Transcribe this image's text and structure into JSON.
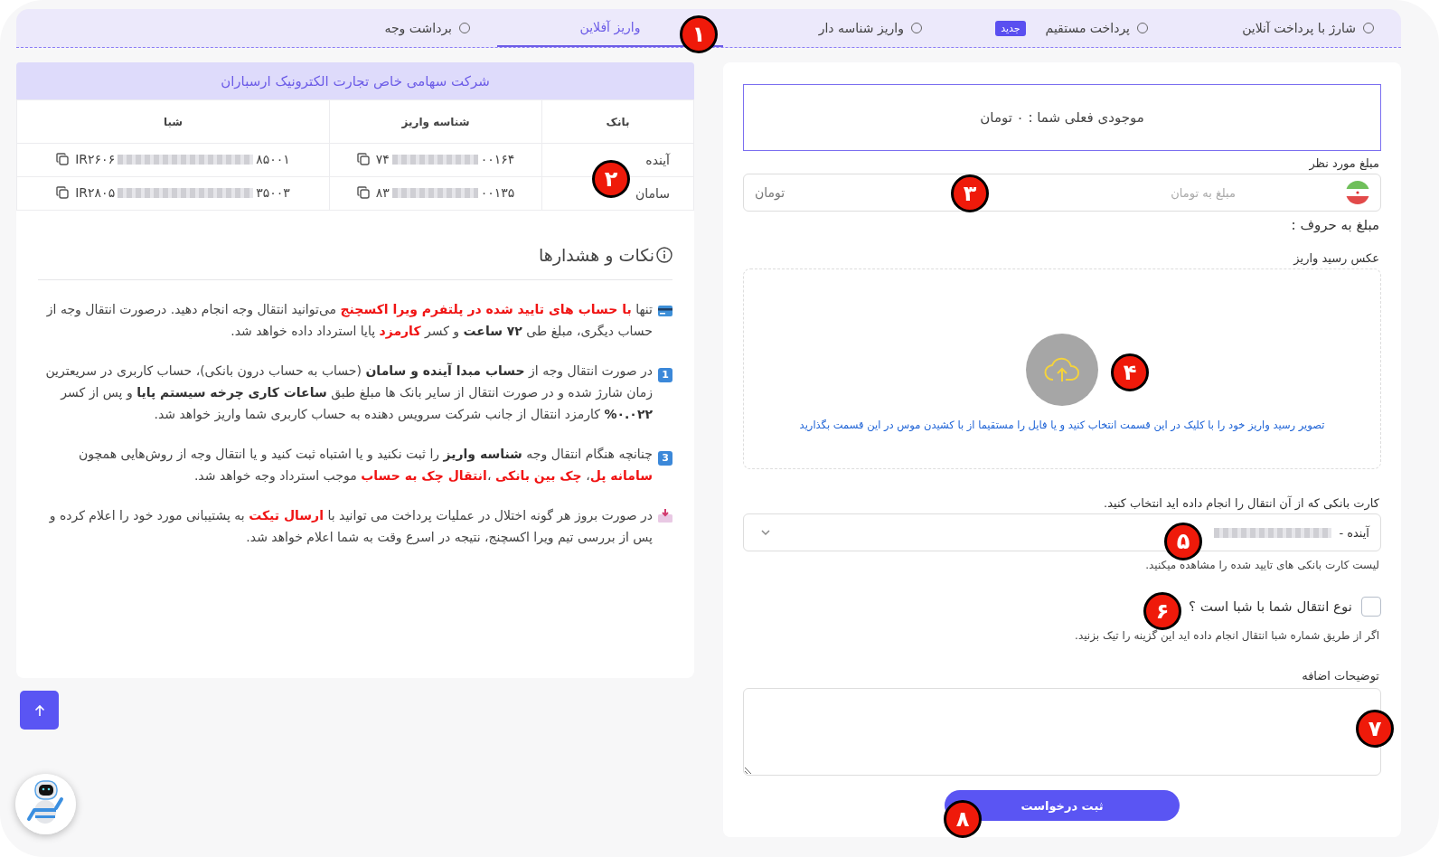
{
  "tabs": [
    {
      "label": "شارژ با پرداخت آنلاین",
      "selected": false
    },
    {
      "label": "پرداخت مستقیم",
      "badge": "جدید",
      "selected": false
    },
    {
      "label": "واریز شناسه دار",
      "selected": false
    },
    {
      "label": "واریز آفلاین",
      "selected": true
    },
    {
      "label": "برداشت وجه",
      "selected": false
    }
  ],
  "form": {
    "balance": "موجودی فعلی شما : ۰ تومان",
    "amount": {
      "label": "مبلغ مورد نظر",
      "placeholder": "مبلغ به تومان",
      "unit": "تومان"
    },
    "amount_words": "مبلغ به حروف :",
    "receipt": {
      "label": "عکس رسید واریز",
      "hint": "تصویر رسید واریز خود را با کلیک در این قسمت انتخاب کنید و یا فایل را مستقیما از با کشیدن موس در این قسمت بگذارید"
    },
    "card_select": {
      "label": "کارت بانکی که از آن انتقال را انجام داده اید انتخاب کنید.",
      "value_prefix": "آینده -",
      "help": "لیست کارت بانکی های تایید شده را مشاهده میکنید."
    },
    "sheba_checkbox": {
      "label": "نوع انتقال شما با شبا است ؟",
      "checked": false,
      "help": "اگر از طریق شماره شبا انتقال انجام داده اید این گزینه را تیک بزنید."
    },
    "notes_field": {
      "label": "توضیحات اضافه"
    },
    "submit": "ثبت درخواست"
  },
  "bank_panel": {
    "title": "شرکت سهامی خاص تجارت الکترونیک ارسباران",
    "columns": [
      "بانک",
      "شناسه واریز",
      "شبا"
    ],
    "rows": [
      {
        "bank": "آینده",
        "deposit_id_start": "۷۴",
        "deposit_id_end": "۰۰۱۶۴",
        "sheba_start": "IR۲۶۰۶",
        "sheba_end": "۸۵۰۰۱"
      },
      {
        "bank": "سامان",
        "deposit_id_start": "۸۳",
        "deposit_id_end": "۰۰۱۳۵",
        "sheba_start": "IR۲۸۰۵",
        "sheba_end": "۳۵۰۰۳"
      }
    ]
  },
  "notes": {
    "title": "نکات و هشدارها",
    "items": [
      {
        "kind": "card",
        "text": "تنها *با حساب های تایید شده در پلتفرم ویرا اکسچنج* می‌توانید انتقال وجه انجام دهید. درصورت انتقال وجه از حساب دیگری، مبلغ طی **۷۲ ساعت** و کسر *کارمزد* پایا استرداد داده خواهد شد."
      },
      {
        "kind": "keycap",
        "keycap": "1",
        "text": "در صورت انتقال وجه از **حساب مبدا آینده و سامان** (حساب به حساب درون بانکی)، حساب کاربری در سریعترین زمان شارژ شده و در صورت انتقال از سایر بانک ها مبلغ طبق **ساعات کاری چرخه سیستم  پایا** و پس از کسر **۰.۰۲۲%** کارمزد انتقال از جانب شرکت سرویس دهنده به حساب کاربری شما واریز خواهد شد."
      },
      {
        "kind": "keycap",
        "keycap": "3",
        "text": "چنانچه هنگام انتقال وجه **شناسه واریز** را ثبت نکنید و یا اشتباه ثبت کنید و یا انتقال وجه از روش‌هایی همچون *سامانه پل*، *چک بین بانکی* ،*انتقال چک به حساب* موجب استرداد وجه خواهد شد."
      },
      {
        "kind": "inbox",
        "text": "در صورت بروز هر گونه اختلال در عملیات پرداخت می توانید با *ارسال تیکت* به پشتیبانی مورد خود را اعلام کرده و پس از بررسی تیم ویرا اکسچنج، نتیجه در اسرع وقت به شما اعلام خواهد شد."
      }
    ]
  },
  "annotations": [
    "۱",
    "۲",
    "۳",
    "۴",
    "۵",
    "۶",
    "۷",
    "۸"
  ]
}
